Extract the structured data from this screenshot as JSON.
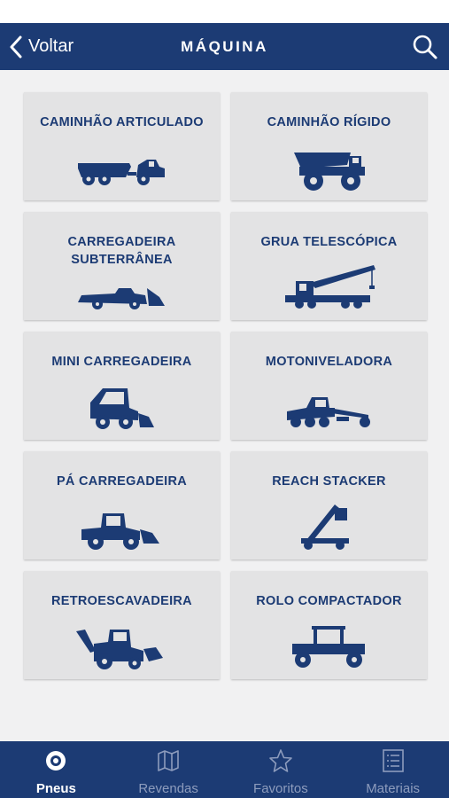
{
  "nav": {
    "back_label": "Voltar",
    "title": "MÁQUINA",
    "search_icon": "search-icon"
  },
  "machines": [
    {
      "label": "CAMINHÃO ARTICULADO",
      "icon": "articulated-truck-icon"
    },
    {
      "label": "CAMINHÃO RÍGIDO",
      "icon": "rigid-truck-icon"
    },
    {
      "label": "CARREGADEIRA\nSUBTERRÂNEA",
      "icon": "underground-loader-icon"
    },
    {
      "label": "GRUA TELESCÓPICA",
      "icon": "telescopic-crane-icon"
    },
    {
      "label": "MINI CARREGADEIRA",
      "icon": "skid-steer-icon"
    },
    {
      "label": "MOTONIVELADORA",
      "icon": "motor-grader-icon"
    },
    {
      "label": "PÁ CARREGADEIRA",
      "icon": "wheel-loader-icon"
    },
    {
      "label": "REACH STACKER",
      "icon": "reach-stacker-icon"
    },
    {
      "label": "RETROESCAVADEIRA",
      "icon": "backhoe-icon"
    },
    {
      "label": "ROLO COMPACTADOR",
      "icon": "roller-compactor-icon"
    }
  ],
  "tabs": [
    {
      "label": "Pneus",
      "icon": "tire-icon",
      "active": true
    },
    {
      "label": "Revendas",
      "icon": "map-icon",
      "active": false
    },
    {
      "label": "Favoritos",
      "icon": "star-icon",
      "active": false
    },
    {
      "label": "Materiais",
      "icon": "list-icon",
      "active": false
    }
  ],
  "colors": {
    "primary": "#1c3b74",
    "background": "#f1f1f2",
    "card": "#e3e3e4",
    "inactive_tab": "#8d9cbd"
  }
}
